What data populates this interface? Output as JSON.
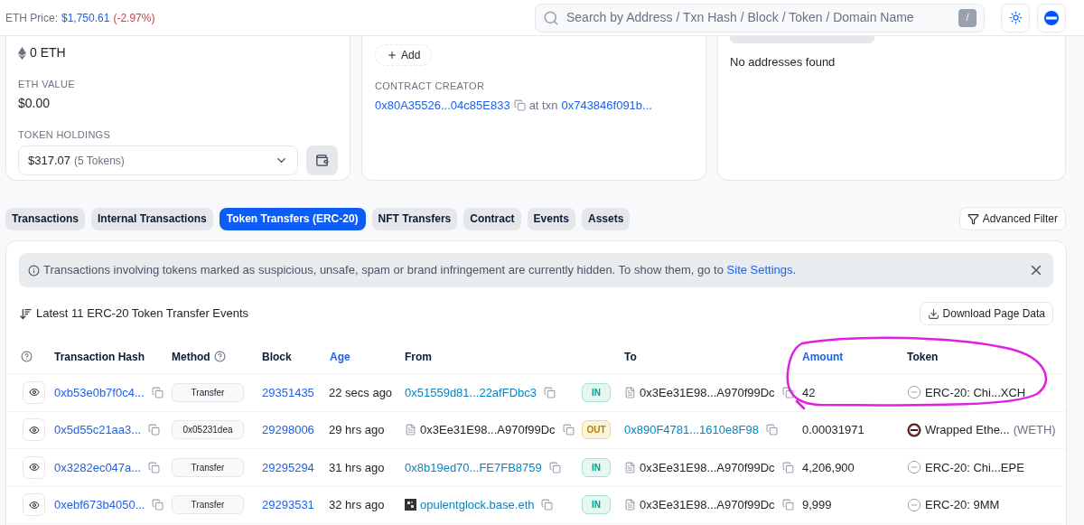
{
  "header": {
    "price_label": "ETH Price:",
    "price": "$1,750.61",
    "change": "(-2.97%)",
    "search": {
      "placeholder": "Search by Address / Txn Hash / Block / Token / Domain Name"
    },
    "shortcut_key": "/"
  },
  "overview": {
    "eth_balance": "0 ETH",
    "eth_value_label": "ETH VALUE",
    "eth_value": "$0.00",
    "holdings_label": "TOKEN HOLDINGS",
    "holdings_value": "$317.07",
    "holdings_count": "(5 Tokens)"
  },
  "more_info": {
    "add_button": "Add",
    "creator_label": "CONTRACT CREATOR",
    "creator_address": "0x80A35526...04c85E833",
    "at_txn": "at txn",
    "creator_txn": "0x743846f091b..."
  },
  "multichain": {
    "message": "No addresses found"
  },
  "tabs": [
    {
      "label": "Transactions",
      "selected": false
    },
    {
      "label": "Internal Transactions",
      "selected": false
    },
    {
      "label": "Token Transfers (ERC-20)",
      "selected": true
    },
    {
      "label": "NFT Transfers",
      "selected": false
    },
    {
      "label": "Contract",
      "selected": false
    },
    {
      "label": "Events",
      "selected": false
    },
    {
      "label": "Assets",
      "selected": false
    }
  ],
  "advanced_filter": "Advanced Filter",
  "alert": {
    "text": "Transactions involving tokens marked as suspicious, unsafe, spam or brand infringement are currently hidden. To show them, go to",
    "link": "Site Settings",
    "end": "."
  },
  "table_title": "Latest 11 ERC-20 Token Transfer Events",
  "download_button": "Download Page Data",
  "table": {
    "columns": [
      {
        "label": "Transaction Hash",
        "sortable": false
      },
      {
        "label": "Method",
        "sortable": false
      },
      {
        "label": "Block",
        "sortable": false
      },
      {
        "label": "Age",
        "sortable": true
      },
      {
        "label": "From",
        "sortable": false
      },
      {
        "label": "To",
        "sortable": false
      },
      {
        "label": "Amount",
        "sortable": true
      },
      {
        "label": "Token",
        "sortable": false
      }
    ],
    "rows": [
      {
        "hash": "0xb53e0b7f0c4...",
        "method": "Transfer",
        "block": "29351435",
        "age": "22 secs ago",
        "from": {
          "text": "0x51559d81...22afFDbc3",
          "kind": "link"
        },
        "direction": {
          "label": "IN",
          "kind": "in"
        },
        "to": {
          "text": "0x3Ee31E98...A970f99Dc",
          "kind": "contract"
        },
        "amount": "42",
        "token": {
          "name": "ERC-20: Chi...XCH",
          "kind": "unknown"
        }
      },
      {
        "hash": "0x5d55c21aa3...",
        "method": "0x05231dea",
        "block": "29298006",
        "age": "29 hrs ago",
        "from": {
          "text": "0x3Ee31E98...A970f99Dc",
          "kind": "contract"
        },
        "direction": {
          "label": "OUT",
          "kind": "out"
        },
        "to": {
          "text": "0x890F4781...1610e8F98",
          "kind": "link"
        },
        "amount": "0.00031971",
        "token": {
          "name": "Wrapped Ethe...",
          "symbol": "(WETH)",
          "kind": "weth"
        }
      },
      {
        "hash": "0x3282ec047a...",
        "method": "Transfer",
        "block": "29295294",
        "age": "31 hrs ago",
        "from": {
          "text": "0x8b19ed70...FE7FB8759",
          "kind": "link"
        },
        "direction": {
          "label": "IN",
          "kind": "in"
        },
        "to": {
          "text": "0x3Ee31E98...A970f99Dc",
          "kind": "contract"
        },
        "amount": "4,206,900",
        "token": {
          "name": "ERC-20: Chi...EPE",
          "kind": "unknown"
        }
      },
      {
        "hash": "0xebf673b4050...",
        "method": "Transfer",
        "block": "29293531",
        "age": "32 hrs ago",
        "from": {
          "text": "opulentglock.base.eth",
          "kind": "named"
        },
        "direction": {
          "label": "IN",
          "kind": "in"
        },
        "to": {
          "text": "0x3Ee31E98...A970f99Dc",
          "kind": "contract"
        },
        "amount": "9,999",
        "token": {
          "name": "ERC-20: 9MM",
          "kind": "unknown"
        }
      }
    ]
  }
}
